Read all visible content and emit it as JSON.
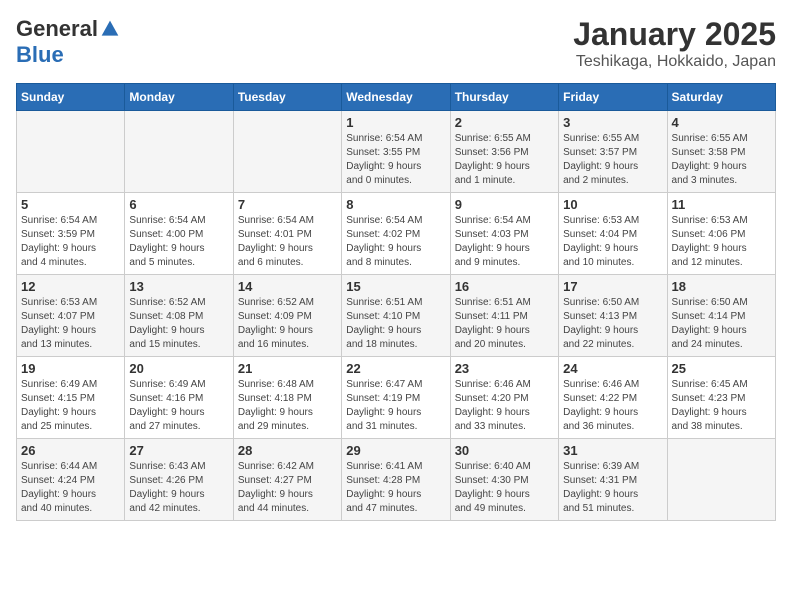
{
  "logo": {
    "general": "General",
    "blue": "Blue"
  },
  "header": {
    "month": "January 2025",
    "location": "Teshikaga, Hokkaido, Japan"
  },
  "weekdays": [
    "Sunday",
    "Monday",
    "Tuesday",
    "Wednesday",
    "Thursday",
    "Friday",
    "Saturday"
  ],
  "weeks": [
    [
      {
        "day": "",
        "info": ""
      },
      {
        "day": "",
        "info": ""
      },
      {
        "day": "",
        "info": ""
      },
      {
        "day": "1",
        "info": "Sunrise: 6:54 AM\nSunset: 3:55 PM\nDaylight: 9 hours\nand 0 minutes."
      },
      {
        "day": "2",
        "info": "Sunrise: 6:55 AM\nSunset: 3:56 PM\nDaylight: 9 hours\nand 1 minute."
      },
      {
        "day": "3",
        "info": "Sunrise: 6:55 AM\nSunset: 3:57 PM\nDaylight: 9 hours\nand 2 minutes."
      },
      {
        "day": "4",
        "info": "Sunrise: 6:55 AM\nSunset: 3:58 PM\nDaylight: 9 hours\nand 3 minutes."
      }
    ],
    [
      {
        "day": "5",
        "info": "Sunrise: 6:54 AM\nSunset: 3:59 PM\nDaylight: 9 hours\nand 4 minutes."
      },
      {
        "day": "6",
        "info": "Sunrise: 6:54 AM\nSunset: 4:00 PM\nDaylight: 9 hours\nand 5 minutes."
      },
      {
        "day": "7",
        "info": "Sunrise: 6:54 AM\nSunset: 4:01 PM\nDaylight: 9 hours\nand 6 minutes."
      },
      {
        "day": "8",
        "info": "Sunrise: 6:54 AM\nSunset: 4:02 PM\nDaylight: 9 hours\nand 8 minutes."
      },
      {
        "day": "9",
        "info": "Sunrise: 6:54 AM\nSunset: 4:03 PM\nDaylight: 9 hours\nand 9 minutes."
      },
      {
        "day": "10",
        "info": "Sunrise: 6:53 AM\nSunset: 4:04 PM\nDaylight: 9 hours\nand 10 minutes."
      },
      {
        "day": "11",
        "info": "Sunrise: 6:53 AM\nSunset: 4:06 PM\nDaylight: 9 hours\nand 12 minutes."
      }
    ],
    [
      {
        "day": "12",
        "info": "Sunrise: 6:53 AM\nSunset: 4:07 PM\nDaylight: 9 hours\nand 13 minutes."
      },
      {
        "day": "13",
        "info": "Sunrise: 6:52 AM\nSunset: 4:08 PM\nDaylight: 9 hours\nand 15 minutes."
      },
      {
        "day": "14",
        "info": "Sunrise: 6:52 AM\nSunset: 4:09 PM\nDaylight: 9 hours\nand 16 minutes."
      },
      {
        "day": "15",
        "info": "Sunrise: 6:51 AM\nSunset: 4:10 PM\nDaylight: 9 hours\nand 18 minutes."
      },
      {
        "day": "16",
        "info": "Sunrise: 6:51 AM\nSunset: 4:11 PM\nDaylight: 9 hours\nand 20 minutes."
      },
      {
        "day": "17",
        "info": "Sunrise: 6:50 AM\nSunset: 4:13 PM\nDaylight: 9 hours\nand 22 minutes."
      },
      {
        "day": "18",
        "info": "Sunrise: 6:50 AM\nSunset: 4:14 PM\nDaylight: 9 hours\nand 24 minutes."
      }
    ],
    [
      {
        "day": "19",
        "info": "Sunrise: 6:49 AM\nSunset: 4:15 PM\nDaylight: 9 hours\nand 25 minutes."
      },
      {
        "day": "20",
        "info": "Sunrise: 6:49 AM\nSunset: 4:16 PM\nDaylight: 9 hours\nand 27 minutes."
      },
      {
        "day": "21",
        "info": "Sunrise: 6:48 AM\nSunset: 4:18 PM\nDaylight: 9 hours\nand 29 minutes."
      },
      {
        "day": "22",
        "info": "Sunrise: 6:47 AM\nSunset: 4:19 PM\nDaylight: 9 hours\nand 31 minutes."
      },
      {
        "day": "23",
        "info": "Sunrise: 6:46 AM\nSunset: 4:20 PM\nDaylight: 9 hours\nand 33 minutes."
      },
      {
        "day": "24",
        "info": "Sunrise: 6:46 AM\nSunset: 4:22 PM\nDaylight: 9 hours\nand 36 minutes."
      },
      {
        "day": "25",
        "info": "Sunrise: 6:45 AM\nSunset: 4:23 PM\nDaylight: 9 hours\nand 38 minutes."
      }
    ],
    [
      {
        "day": "26",
        "info": "Sunrise: 6:44 AM\nSunset: 4:24 PM\nDaylight: 9 hours\nand 40 minutes."
      },
      {
        "day": "27",
        "info": "Sunrise: 6:43 AM\nSunset: 4:26 PM\nDaylight: 9 hours\nand 42 minutes."
      },
      {
        "day": "28",
        "info": "Sunrise: 6:42 AM\nSunset: 4:27 PM\nDaylight: 9 hours\nand 44 minutes."
      },
      {
        "day": "29",
        "info": "Sunrise: 6:41 AM\nSunset: 4:28 PM\nDaylight: 9 hours\nand 47 minutes."
      },
      {
        "day": "30",
        "info": "Sunrise: 6:40 AM\nSunset: 4:30 PM\nDaylight: 9 hours\nand 49 minutes."
      },
      {
        "day": "31",
        "info": "Sunrise: 6:39 AM\nSunset: 4:31 PM\nDaylight: 9 hours\nand 51 minutes."
      },
      {
        "day": "",
        "info": ""
      }
    ]
  ]
}
